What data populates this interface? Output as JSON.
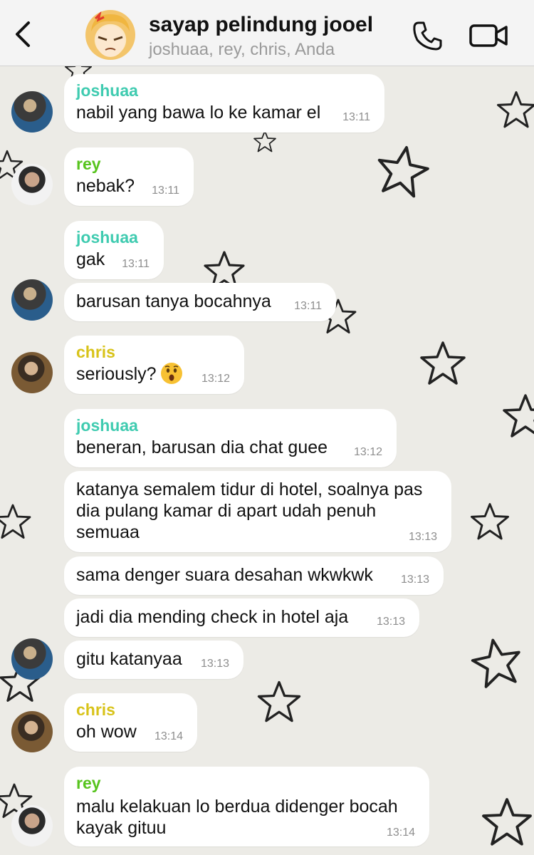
{
  "header": {
    "back_icon": "chevron-left-icon",
    "title": "sayap pelindung jooel",
    "members": "joshuaa, rey, chris, Anda",
    "call_icon": "phone-icon",
    "video_icon": "video-camera-icon"
  },
  "colors": {
    "joshuaa": "#3fcbb0",
    "rey": "#57c41e",
    "chris": "#d8c31a",
    "background": "#ecebe6"
  },
  "messages": [
    {
      "sender": "joshuaa",
      "text": "nabil yang bawa lo ke kamar el",
      "time": "13:11"
    },
    {
      "sender": "rey",
      "text": "nebak?",
      "time": "13:11"
    },
    {
      "sender": "joshuaa",
      "text": "gak",
      "time": "13:11"
    },
    {
      "text": "barusan tanya bocahnya",
      "time": "13:11"
    },
    {
      "sender": "chris",
      "text": "seriously?",
      "emoji": "astonished-face",
      "time": "13:12"
    },
    {
      "sender": "joshuaa",
      "text": "beneran, barusan dia chat guee",
      "time": "13:12"
    },
    {
      "line1": "katanya semalem tidur di hotel, soalnya pas",
      "line2": "dia pulang kamar di apart udah penuh",
      "line3": "semuaa",
      "time": "13:13"
    },
    {
      "text": "sama denger suara desahan wkwkwk",
      "time": "13:13"
    },
    {
      "text": "jadi dia mending check in hotel aja",
      "time": "13:13"
    },
    {
      "text": "gitu katanyaa",
      "time": "13:13"
    },
    {
      "sender": "chris",
      "text": "oh wow",
      "time": "13:14"
    },
    {
      "sender": "rey",
      "line1": "malu kelakuan lo berdua didenger bocah",
      "line2": "kayak gituu",
      "time": "13:14"
    }
  ]
}
